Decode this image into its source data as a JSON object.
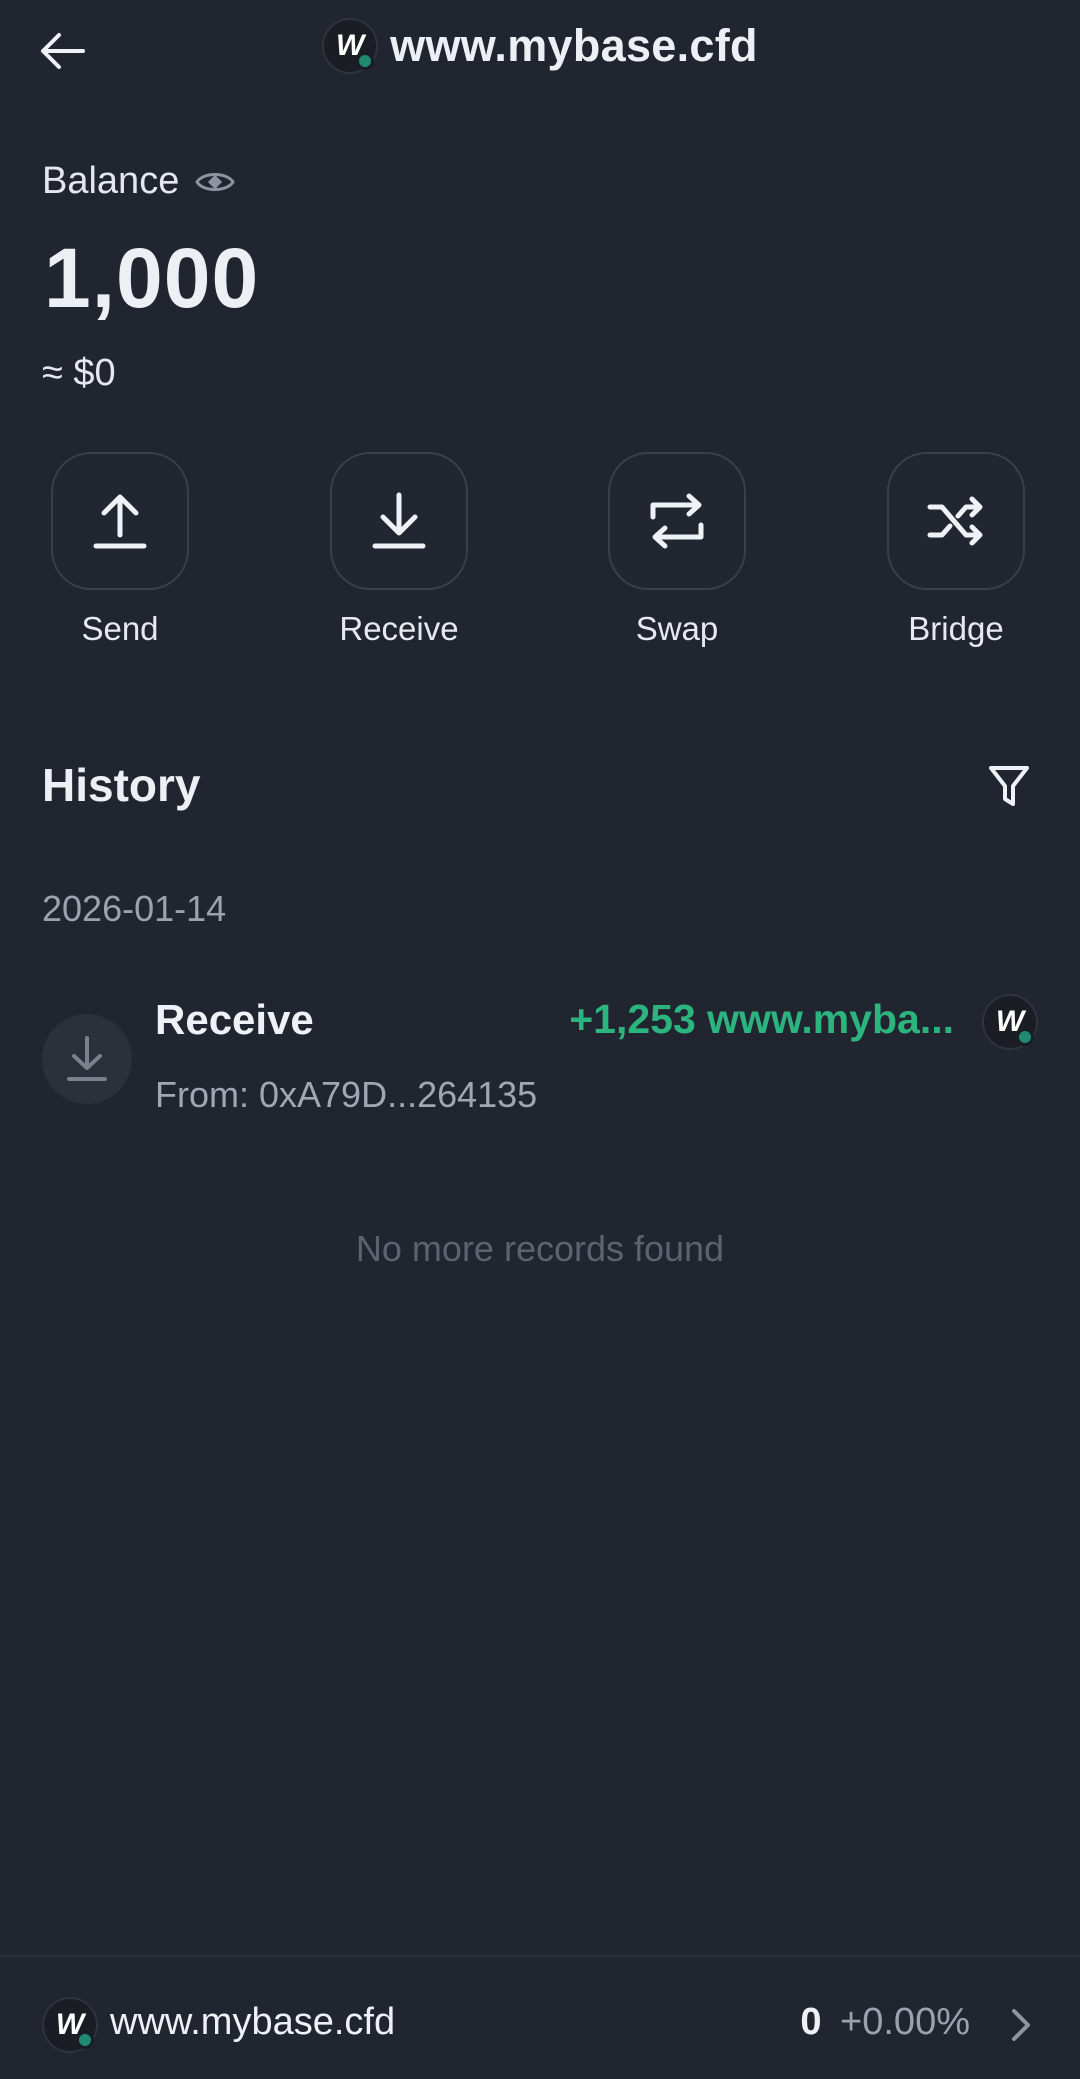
{
  "header": {
    "title": "www.mybase.cfd",
    "back_icon": "arrow-left-icon",
    "logo_letter": "W"
  },
  "balance": {
    "label": "Balance",
    "amount": "1,000",
    "fiat": "≈ $0"
  },
  "actions": [
    {
      "label": "Send",
      "icon": "upload-icon"
    },
    {
      "label": "Receive",
      "icon": "download-icon"
    },
    {
      "label": "Swap",
      "icon": "swap-icon"
    },
    {
      "label": "Bridge",
      "icon": "shuffle-icon"
    }
  ],
  "history": {
    "title": "History",
    "groups": [
      {
        "date": "2026-01-14",
        "items": [
          {
            "type": "Receive",
            "from": "From: 0xA79D...264135",
            "amount": "+1,253 www.myba..."
          }
        ]
      }
    ],
    "end_text": "No more records found"
  },
  "footer": {
    "token_name": "www.mybase.cfd",
    "balance": "0",
    "change": "+0.00%"
  },
  "colors": {
    "background": "#21252f",
    "positive": "#2bb47e",
    "muted": "#9ba1ad"
  }
}
